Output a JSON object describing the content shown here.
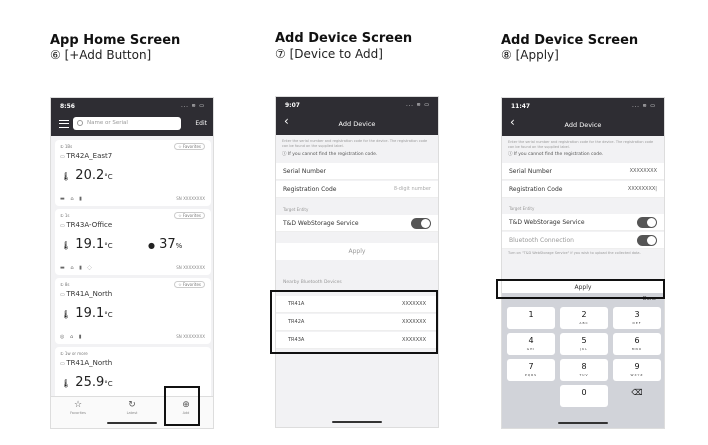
{
  "panels": [
    {
      "title": "App Home Screen",
      "subtitle": "⑥ [+Add Button]",
      "time": "8:56",
      "status_icons": "...  ≋  ▭",
      "search_placeholder": "Name or Serial",
      "edit_label": "Edit",
      "cards": [
        {
          "num": "① 1Bs",
          "fav": "☆ Favorites",
          "name": "TR42A_East7",
          "temp": "20.2",
          "unit": "°C",
          "hum": "",
          "hum_unit": "",
          "icons": "▬ ⌂ ▮",
          "id": "SN XXXXXXXX"
        },
        {
          "num": "① 1s",
          "fav": "☆ Favorites",
          "name": "TR43A-Office",
          "temp": "19.1",
          "unit": "°C",
          "hum": "37",
          "hum_unit": "%",
          "icons": "▬ ⌂ ▮ ◌",
          "id": "SN XXXXXXXX"
        },
        {
          "num": "① 8s",
          "fav": "☆ Favorites",
          "name": "TR41A_North",
          "temp": "19.1",
          "unit": "°C",
          "hum": "",
          "hum_unit": "",
          "icons": "◎ ⌂ ▮",
          "id": "SN XXXXXXXX"
        },
        {
          "num": "① 1w or more",
          "fav": "",
          "name": "TR41A_North",
          "temp": "25.9",
          "unit": "°C",
          "hum": "",
          "hum_unit": "",
          "icons": "",
          "id": ""
        }
      ],
      "tabs": [
        {
          "icon": "☆",
          "label": "Favorites"
        },
        {
          "icon": "↻",
          "label": "Latest"
        },
        {
          "icon": "⊕",
          "label": "Add"
        }
      ]
    },
    {
      "title": "Add Device Screen",
      "subtitle": "⑦ [Device to Add]",
      "time": "9:07",
      "status_icons": "...  ≋  ▭",
      "screen_title": "Add Device",
      "desc": "Enter the serial number and registration code for the device. The registration code can be found on the supplied label.",
      "help": "ⓘ If you cannot find the registration code.",
      "serial_label": "Serial Number",
      "reg_label": "Registration Code",
      "reg_placeholder": "8-digit number",
      "target_section": "Target Entity",
      "service_label": "T&D WebStorage Service",
      "apply_label": "Apply",
      "nearby_section": "Nearby Bluetooth Devices",
      "devices": [
        {
          "name": "TR41A",
          "serial": "XXXXXXX"
        },
        {
          "name": "TR42A",
          "serial": "XXXXXXX"
        },
        {
          "name": "TR43A",
          "serial": "XXXXXXX"
        }
      ]
    },
    {
      "title": "Add Device Screen",
      "subtitle": "⑧ [Apply]",
      "time": "11:47",
      "status_icons": "...  ≋  ▭",
      "screen_title": "Add Device",
      "desc": "Enter the serial number and registration code for the device. The registration code can be found on the supplied label.",
      "help": "ⓘ If you cannot find the registration code.",
      "serial_label": "Serial Number",
      "serial_value": "XXXXXXXX",
      "reg_label": "Registration Code",
      "reg_value": "XXXXXXXX|",
      "target_section": "Target Entity",
      "service_label": "T&D WebStorage Service",
      "bt_label": "Bluetooth Connection",
      "bt_note": "Turn on \"T&D WebStorage Service\" if you wish to upload the collected data.",
      "apply_label": "Apply",
      "done_label": "Done",
      "keys": [
        {
          "n": "1",
          "l": ""
        },
        {
          "n": "2",
          "l": "ABC"
        },
        {
          "n": "3",
          "l": "DEF"
        },
        {
          "n": "4",
          "l": "GHI"
        },
        {
          "n": "5",
          "l": "JKL"
        },
        {
          "n": "6",
          "l": "MNO"
        },
        {
          "n": "7",
          "l": "PQRS"
        },
        {
          "n": "8",
          "l": "TUV"
        },
        {
          "n": "9",
          "l": "WXYZ"
        },
        {
          "n": "",
          "l": ""
        },
        {
          "n": "0",
          "l": ""
        },
        {
          "n": "⌫",
          "l": ""
        }
      ]
    }
  ]
}
